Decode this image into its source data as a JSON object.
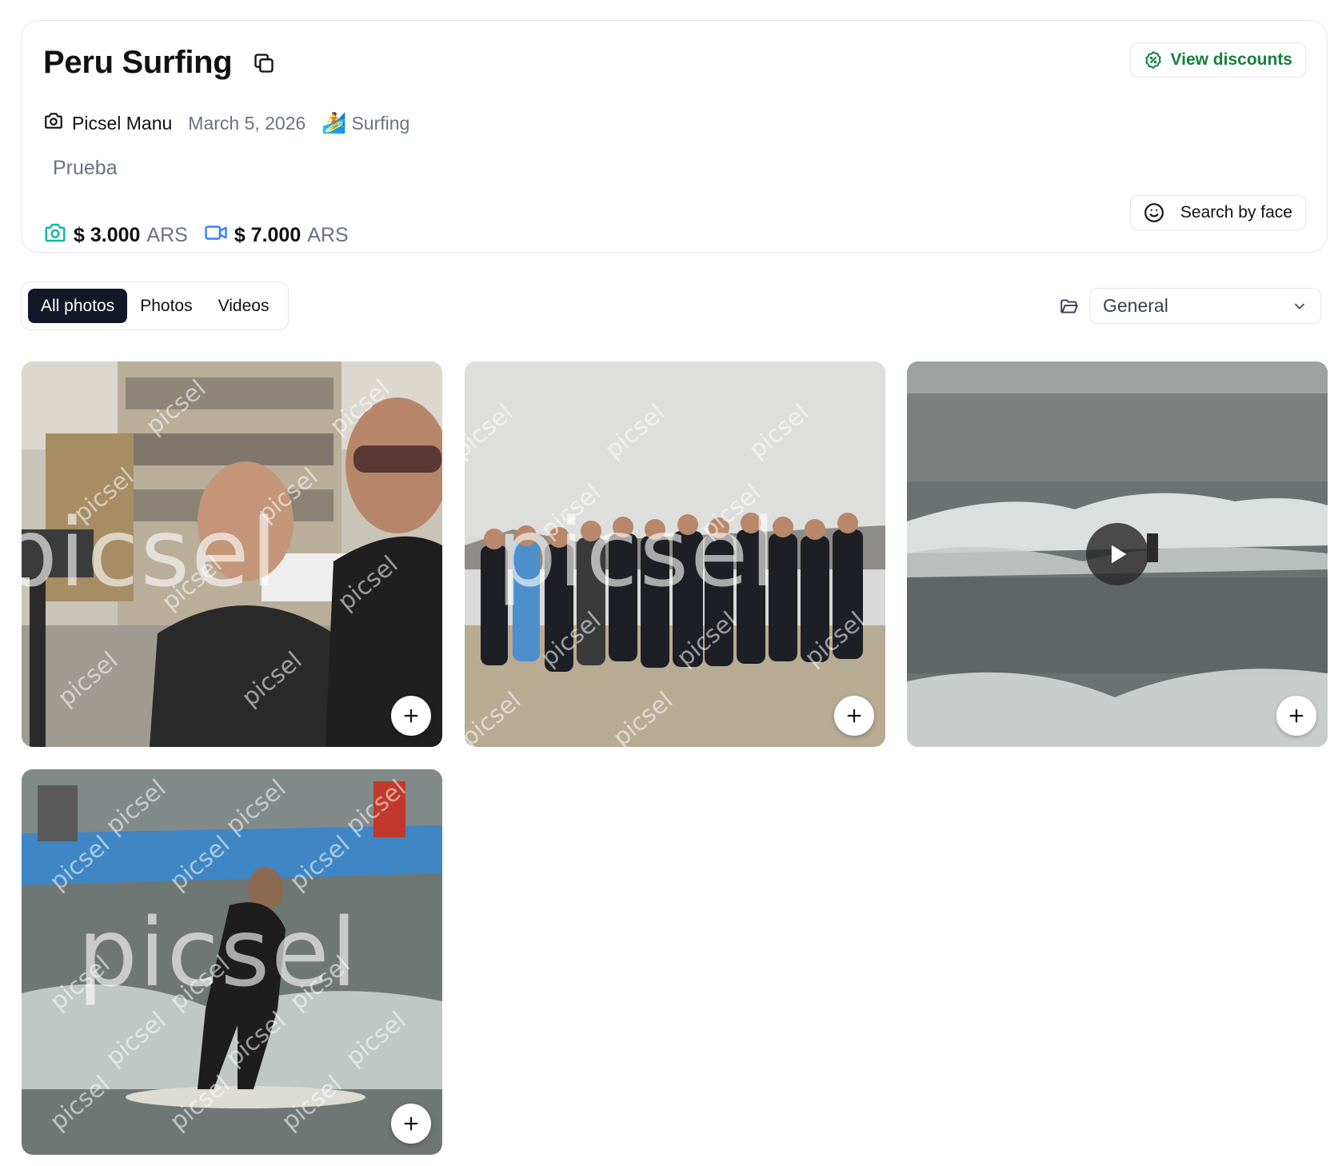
{
  "event": {
    "title": "Peru Surfing",
    "photographer": "Picsel Manu",
    "date": "March 5, 2026",
    "sport_emoji": "🏄",
    "sport": "Surfing",
    "description": "Prueba",
    "photo_price": "$ 3.000",
    "photo_currency": "ARS",
    "video_price": "$ 7.000",
    "video_currency": "ARS",
    "discounts_label": "View discounts",
    "face_search_label": "Search by face"
  },
  "filters": {
    "tabs": [
      {
        "label": "All photos",
        "active": true
      },
      {
        "label": "Photos",
        "active": false
      },
      {
        "label": "Videos",
        "active": false
      }
    ],
    "album_selected": "General"
  },
  "gallery": {
    "watermark_text": "picsel",
    "items": [
      {
        "type": "photo",
        "subject": "selfie of two smiling men in hoodies"
      },
      {
        "type": "photo",
        "subject": "group of people in wetsuits standing on the beach"
      },
      {
        "type": "video",
        "subject": "surfer riding a wave"
      },
      {
        "type": "photo",
        "subject": "surfer standing on board near fishing boat"
      }
    ]
  },
  "colors": {
    "accent_green": "#15803d",
    "photo_icon": "#14b8a6",
    "video_icon": "#3b82f6",
    "active_tab_bg": "#111827"
  }
}
